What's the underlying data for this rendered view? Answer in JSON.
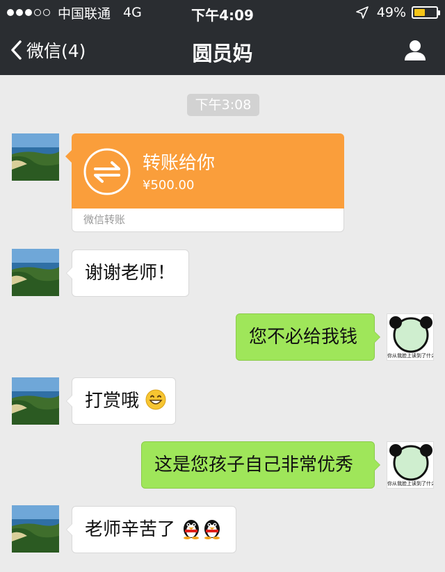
{
  "status_bar": {
    "carrier": "中国联通",
    "network": "4G",
    "time": "下午4:09",
    "battery": "49%",
    "battery_level": 0.49
  },
  "nav": {
    "back_label": "微信(4)",
    "title": "圆员妈"
  },
  "chat": {
    "timestamp": "下午3:08",
    "transfer": {
      "title": "转账给你",
      "amount": "¥500.00",
      "footer": "微信转账"
    },
    "messages": [
      {
        "side": "left",
        "text": "谢谢老师！"
      },
      {
        "side": "right",
        "text": "您不必给我钱",
        "sticker_caption": "你从我脸上读到了什么"
      },
      {
        "side": "left",
        "text": "打赏哦",
        "emoji": "grin"
      },
      {
        "side": "right",
        "text": "这是您孩子自己非常优秀",
        "sticker_caption": "你从我脸上读到了什么"
      },
      {
        "side": "left",
        "text": "老师辛苦了",
        "emoji": "penguin x2"
      }
    ]
  },
  "colors": {
    "bar": "#2a2d31",
    "chat_bg": "#ebebeb",
    "bubble_green": "#9fe65a",
    "transfer_orange": "#fa9e3b",
    "battery_yellow": "#f5c518"
  },
  "icons": {
    "back": "chevron-left-icon",
    "profile": "person-icon",
    "location": "location-arrow-icon",
    "transfer": "transfer-arrows-icon"
  }
}
